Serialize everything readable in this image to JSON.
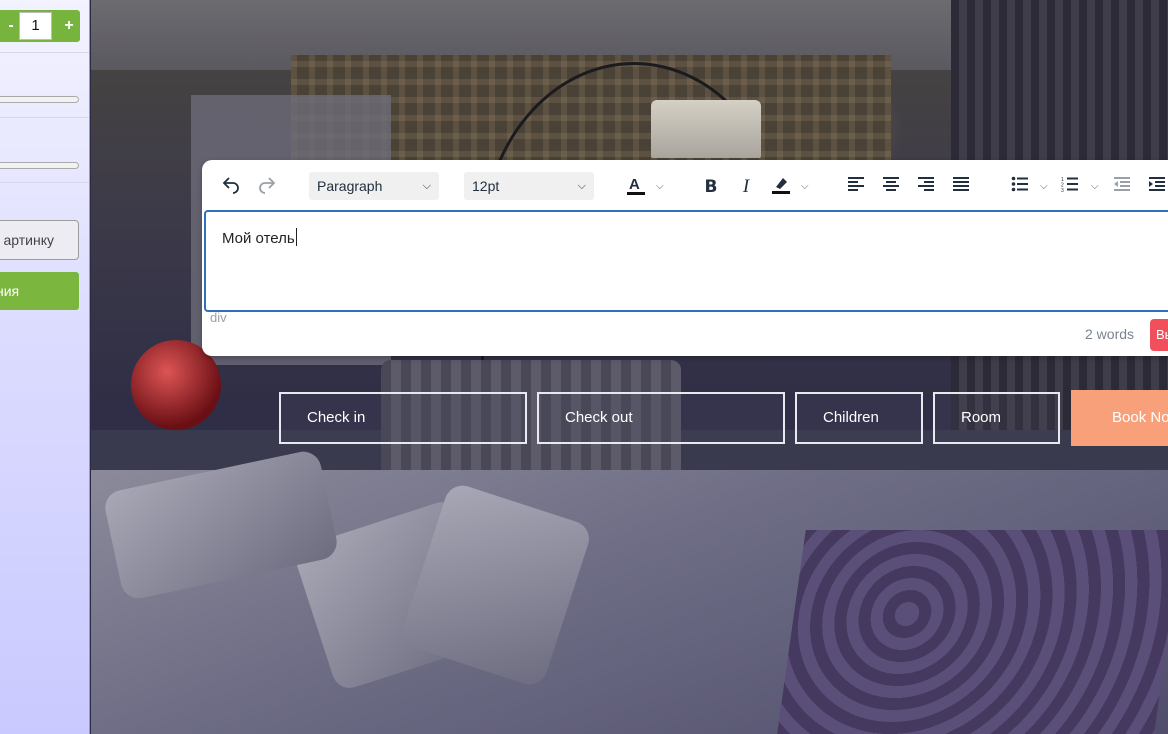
{
  "sidebar": {
    "stepper": {
      "minus": "-",
      "value": "1",
      "plus": "+"
    },
    "image_button_label": "артинку",
    "apply_button_label": "ния"
  },
  "editor": {
    "toolbar": {
      "undo_icon": "undo-icon",
      "redo_icon": "redo-icon",
      "block_format": "Paragraph",
      "font_size": "12pt",
      "icons": [
        "text-color-icon",
        "bold-icon",
        "italic-icon",
        "highlight-icon",
        "align-left-icon",
        "align-center-icon",
        "align-right-icon",
        "align-justify-icon",
        "bullet-list-icon",
        "numbered-list-icon",
        "outdent-icon",
        "indent-icon"
      ]
    },
    "content_text": "Мой отель",
    "statusbar": {
      "path": "div",
      "word_count": "2 words",
      "action_button": "Вы"
    }
  },
  "booking": {
    "check_in": "Check in",
    "check_out": "Check out",
    "children": "Children",
    "room": "Room",
    "book_now": "Book No"
  },
  "colors": {
    "editor_focus": "#2f6fbd",
    "book_button": "#f7a07a",
    "sidebar_green": "#76b43d",
    "editor_action_red": "#f0505c"
  }
}
